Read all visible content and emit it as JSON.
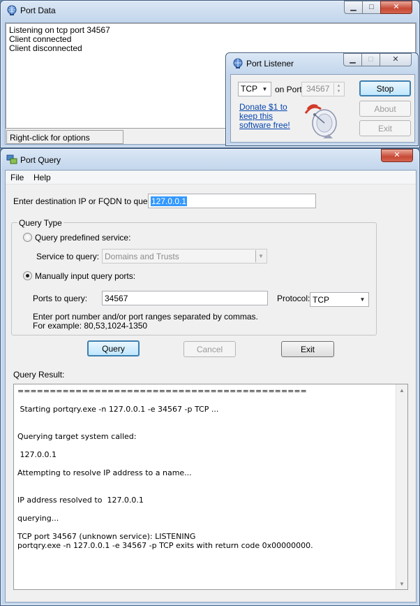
{
  "port_data": {
    "title": "Port Data",
    "log_lines": [
      "Listening on tcp port 34567",
      "Client connected",
      "Client disconnected"
    ],
    "status": "Right-click for options"
  },
  "port_listener": {
    "title": "Port Listener",
    "protocol": "TCP",
    "on_port_label": "on Port:",
    "port_value": "34567",
    "donate_text": [
      "Donate $1 to",
      "keep this",
      "software free!"
    ],
    "stop_label": "Stop",
    "about_label": "About",
    "exit_label": "Exit"
  },
  "port_query": {
    "title": "Port Query",
    "menu": [
      "File",
      "Help"
    ],
    "dest_label": "Enter destination IP or FQDN to query:",
    "dest_value": "127.0.0.1",
    "query_type_title": "Query Type",
    "predefined_label": "Query predefined service:",
    "service_label": "Service to query:",
    "service_value": "Domains and Trusts",
    "manual_label": "Manually input query ports:",
    "ports_label": "Ports to query:",
    "ports_value": "34567",
    "protocol_label": "Protocol:",
    "protocol_value": "TCP",
    "hint_line1": "Enter port number and/or port ranges separated by commas.",
    "hint_line2": "For example: 80,53,1024-1350",
    "query_label": "Query",
    "cancel_label": "Cancel",
    "exit_label": "Exit",
    "result_label": "Query Result:",
    "result_lines": [
      "=============================================",
      " Starting portqry.exe -n 127.0.0.1 -e 34567 -p TCP ...",
      "Querying target system called:",
      " 127.0.0.1",
      "Attempting to resolve IP address to a name...",
      "IP address resolved to  127.0.0.1",
      "querying...",
      "TCP port 34567 (unknown service): LISTENING",
      "portqry.exe -n 127.0.0.1 -e 34567 -p TCP exits with return code 0x00000000."
    ]
  }
}
